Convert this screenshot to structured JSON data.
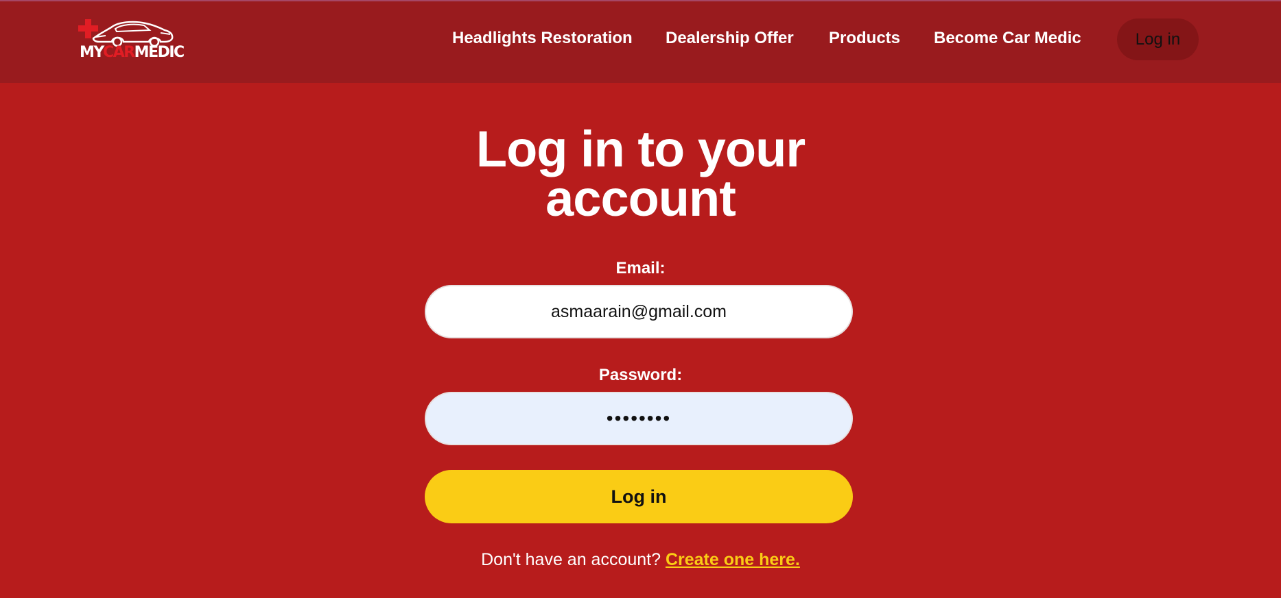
{
  "header": {
    "logo": {
      "text_my": "MY",
      "text_car": "CAR",
      "text_medic": "MEDIC",
      "icon": "car-with-red-cross-logo"
    },
    "nav": [
      {
        "label": "Headlights Restoration"
      },
      {
        "label": "Dealership Offer"
      },
      {
        "label": "Products"
      },
      {
        "label": "Become Car Medic"
      }
    ],
    "login_label": "Log in"
  },
  "form": {
    "title_line1": "Log in to your",
    "title_line2": "account",
    "email_label": "Email:",
    "email_value": "asmaarain@gmail.com",
    "password_label": "Password:",
    "password_value": "••••••••",
    "submit_label": "Log in",
    "signup_text": "Don't have an account? ",
    "signup_link": "Create one here."
  },
  "colors": {
    "page_bg": "#b71c1c",
    "header_bg": "#991b1e",
    "accent": "#facc15",
    "login_button_bg": "#841517"
  }
}
